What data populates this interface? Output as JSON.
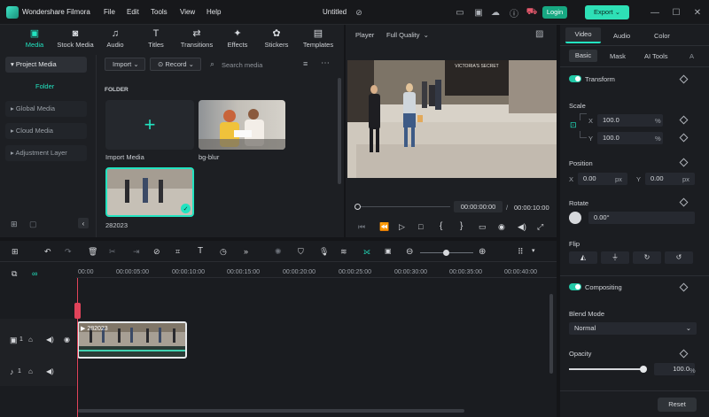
{
  "app": {
    "name": "Wondershare Filmora",
    "project_title": "Untitled",
    "login_label": "Login",
    "export_label": "Export"
  },
  "menu": [
    "File",
    "Edit",
    "Tools",
    "View",
    "Help"
  ],
  "window_controls": [
    "minimize",
    "maximize",
    "close"
  ],
  "toolbar_tabs": [
    {
      "label": "Media",
      "icon": "media-icon",
      "active": true
    },
    {
      "label": "Stock Media",
      "icon": "stock-media-icon"
    },
    {
      "label": "Audio",
      "icon": "audio-icon"
    },
    {
      "label": "Titles",
      "icon": "titles-icon"
    },
    {
      "label": "Transitions",
      "icon": "transitions-icon"
    },
    {
      "label": "Effects",
      "icon": "effects-icon"
    },
    {
      "label": "Stickers",
      "icon": "stickers-icon"
    },
    {
      "label": "Templates",
      "icon": "templates-icon"
    }
  ],
  "sidebar": {
    "items": [
      {
        "label": "Project Media",
        "active": true
      },
      {
        "label": "Folder",
        "sub": true
      },
      {
        "label": "Global Media"
      },
      {
        "label": "Cloud Media"
      },
      {
        "label": "Adjustment Layer"
      }
    ]
  },
  "media": {
    "import_label": "Import",
    "record_label": "Record",
    "search_placeholder": "Search media",
    "folder_label": "FOLDER",
    "items": [
      {
        "label": "Import Media"
      },
      {
        "label": "bg-blur"
      },
      {
        "label": "282023"
      }
    ]
  },
  "player": {
    "label": "Player",
    "quality": "Full Quality",
    "current_time": "00:00:00:00",
    "total_time": "00:00:10:00",
    "scene_sign": "VICTORIA'S SECRET"
  },
  "inspector": {
    "tabs": [
      "Video",
      "Audio",
      "Color"
    ],
    "subtabs": [
      "Basic",
      "Mask",
      "AI Tools"
    ],
    "transform_label": "Transform",
    "scale_label": "Scale",
    "scale_x": "100.0",
    "scale_y": "100.0",
    "percent": "%",
    "position_label": "Position",
    "pos_x": "0.00",
    "pos_y": "0.00",
    "px": "px",
    "rotate_label": "Rotate",
    "rotate_value": "0.00°",
    "flip_label": "Flip",
    "compositing_label": "Compositing",
    "blend_label": "Blend Mode",
    "blend_value": "Normal",
    "opacity_label": "Opacity",
    "opacity_value": "100.0",
    "opacity_level": 1.0,
    "reset_label": "Reset",
    "axis_x": "X",
    "axis_y": "Y"
  },
  "timeline": {
    "ruler": [
      "00:00",
      "00:00:05:00",
      "00:00:10:00",
      "00:00:15:00",
      "00:00:20:00",
      "00:00:25:00",
      "00:00:30:00",
      "00:00:35:00",
      "00:00:40:00"
    ],
    "clip_label": "282023",
    "track_video": "1",
    "track_audio": "1"
  },
  "colors": {
    "accent": "#22e3c0",
    "export": "#2ee0b6",
    "playhead": "#e0435a"
  }
}
